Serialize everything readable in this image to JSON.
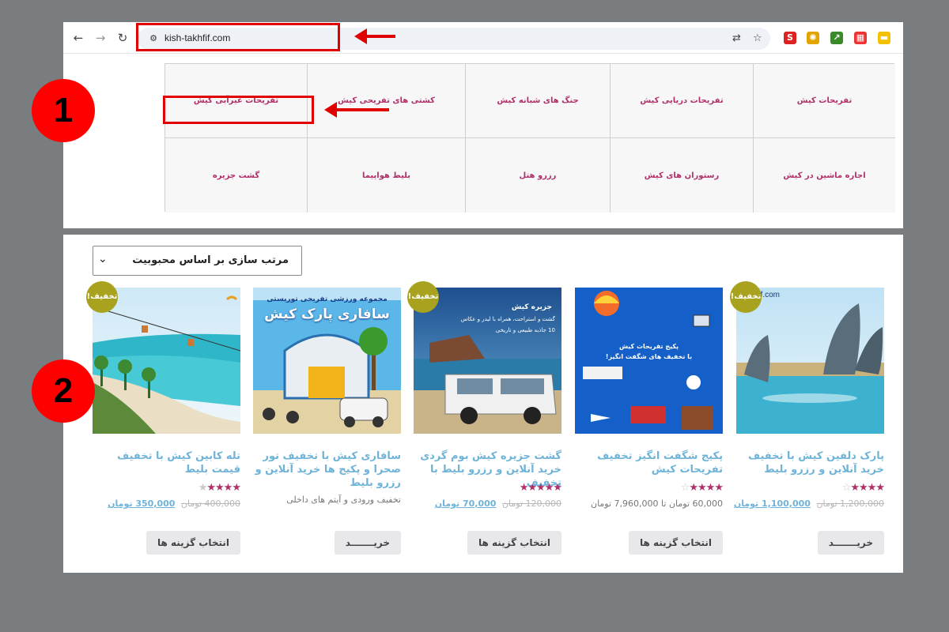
{
  "browser": {
    "url": "kish-takhfif.com",
    "back_glyph": "←",
    "forward_glyph": "→",
    "reload_glyph": "↻"
  },
  "categories": [
    "گشت جزیره",
    "تفریحات غیرآبی کیش",
    "کشتی های تفریحی کیش",
    "بلیط هواپیما",
    "جنگ های شبانه کیش",
    "رزرو هتل",
    "تفریحات دریایی کیش",
    "رستوران های کیش",
    "تفریحات کیش",
    "اجاره ماشین در کیش"
  ],
  "sort": {
    "label": "مرتب سازی بر اساس محبوبیت"
  },
  "products": [
    {
      "title": "تله کابین کیش با تخفیف قیمت بلیط",
      "badge": "تخفیف!",
      "old_price": "400,000 تومان",
      "new_price": "350,000 تومان",
      "button": "انتخاب گزینه ها",
      "rating": 4.5
    },
    {
      "title": "سافاری کیش با تخفیف تور صحرا و پکیج ها خرید آنلاین و رزرو بلیط",
      "badge": "",
      "price_text": "تخفیف ورودی و آیتم های داخلی",
      "button": "خریـــــــد",
      "rating": 0
    },
    {
      "title": "گشت جزیره کیش بوم گردی خرید آنلاین و رزرو بلیط با تخفیف",
      "badge": "تخفیف!",
      "old_price": "120,000 تومان",
      "new_price": "70,000 تومان",
      "button": "انتخاب گزینه ها",
      "rating": 5
    },
    {
      "title": "پکیج شگفت انگیز تخفیف تفریحات کیش",
      "badge": "",
      "price_text": "60,000 تومان تا 7,960,000 تومان",
      "button": "انتخاب گزینه ها",
      "rating": 4
    },
    {
      "title": "پارک دلفین کیش با تخفیف خرید آنلاین و رزرو بلیط",
      "badge": "تخفیف!",
      "old_price": "1,200,000 تومان",
      "new_price": "1,100,000 تومان",
      "button": "خریـــــــد",
      "rating": 5
    }
  ],
  "image_texts": {
    "dolphin_site": "hfif.com",
    "safari_header": "مجموعه ورزشی تفریحی توریستی",
    "safari_title": "سافاری پارک کیش",
    "tour_title": "جزیره کیش",
    "tour_line1": "گشت و استراحت، همراه با لیدر و عکاس",
    "tour_line2": "10 جاذبه طبیعی و تاریخی",
    "package_line1": "پکیج تفریحات کیش",
    "package_line2": "با تخفیف های شگفت انگیز!"
  },
  "annotations": {
    "step1": "1",
    "step2": "2"
  },
  "colors": {
    "accent": "#b0306a",
    "link": "#6fb3d9",
    "badge": "#a8a21e",
    "annotation": "#e10000"
  }
}
